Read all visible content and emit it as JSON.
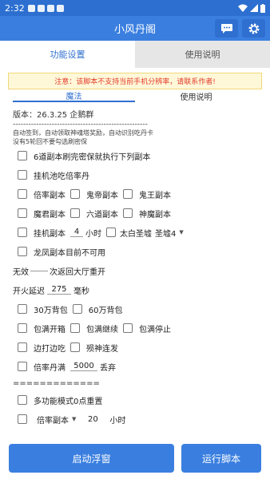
{
  "statusbar": {
    "time": "2:32"
  },
  "app": {
    "title": "小风丹阁"
  },
  "tabs": {
    "settings": "功能设置",
    "help": "使用说明"
  },
  "notice": "注意：该脚本不支持当前手机分辨率，请联系作者!",
  "subtabs": {
    "magic": "魔法",
    "help": "使用说明"
  },
  "info": {
    "version": "版本：26.3.25 企鹅群",
    "dashes": "----------------------------------------------------",
    "desc1": "自动签到，自动领取神魂塔奖励，自动识别吃丹卡",
    "desc2": "没有5轮回不要勾选刷密保"
  },
  "rows": {
    "r1": "6道副本刷完密保就执行下列副本",
    "r2": "挂机池吃倍率丹",
    "r3": [
      "倍率副本",
      "鬼帝副本",
      "鬼王副本"
    ],
    "r4": [
      "魔君副本",
      "六道副本",
      "神魔副本"
    ],
    "r5": {
      "label": "挂机副本",
      "hours": "4",
      "unit": "小时",
      "label2": "太白圣墟",
      "select": "圣墟4"
    },
    "r6": "龙凤副本目前不可用",
    "r7": {
      "prefix": "无效",
      "value": "",
      "suffix": "次返回大厅重开"
    },
    "r8": {
      "prefix": "开火延迟",
      "value": "275",
      "suffix": "毫秒"
    },
    "r9": [
      "30万背包",
      "60万背包"
    ],
    "r10": [
      "包满开箱",
      "包满继续",
      "包满停止"
    ],
    "r11": [
      "边打边吃",
      "殒神连发"
    ],
    "r12": {
      "label": "倍率丹满",
      "value": "5000",
      "suffix": "丢弃"
    },
    "r13": "=============",
    "r14": "多功能模式0点重置",
    "r15": {
      "select": "倍率副本",
      "value": "20",
      "suffix": "小时"
    }
  },
  "buttons": {
    "float": "启动浮窗",
    "run": "运行脚本"
  }
}
